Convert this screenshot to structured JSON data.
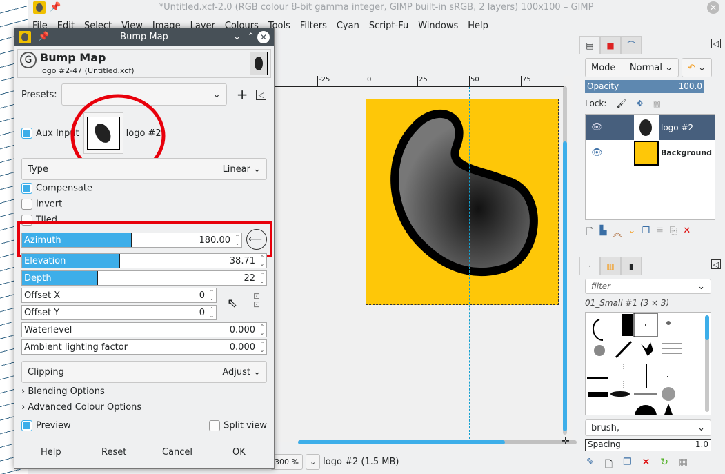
{
  "window": {
    "title": "*Untitled.xcf-2.0 (RGB colour 8-bit gamma integer, GIMP built-in sRGB, 2 layers) 100x100 – GIMP"
  },
  "menu": [
    "File",
    "Edit",
    "Select",
    "View",
    "Image",
    "Layer",
    "Colours",
    "Tools",
    "Filters",
    "Cyan",
    "Script-Fu",
    "Windows",
    "Help"
  ],
  "ruler": [
    "-25",
    "0",
    "25",
    "50",
    "75"
  ],
  "status": {
    "zoom": "300 %",
    "info": "logo #2 (1.5 MB)"
  },
  "layers_panel": {
    "mode_label": "Mode",
    "mode_value": "Normal",
    "opacity_label": "Opacity",
    "opacity_value": "100.0",
    "lock_label": "Lock:",
    "layers": [
      {
        "name": "logo #2",
        "selected": true
      },
      {
        "name": "Background",
        "selected": false
      }
    ]
  },
  "brushes_panel": {
    "filter_placeholder": "filter",
    "brush_name": "01_Small #1 (3 × 3)",
    "tag": "brush,",
    "spacing_label": "Spacing",
    "spacing_value": "1.0"
  },
  "dialog": {
    "title": "Bump Map",
    "heading": "Bump Map",
    "subheading": "logo #2-47 (Untitled.xcf)",
    "presets_label": "Presets:",
    "aux_input_label": "Aux Input",
    "aux_input_checked": true,
    "aux_layer": "logo #2",
    "type_label": "Type",
    "type_value": "Linear",
    "compensate": "Compensate",
    "compensate_checked": true,
    "invert": "Invert",
    "invert_checked": false,
    "tiled": "Tiled",
    "tiled_checked": false,
    "azimuth_label": "Azimuth",
    "azimuth_value": "180.00",
    "azimuth_fraction": 0.5,
    "elevation_label": "Elevation",
    "elevation_value": "38.71",
    "elevation_fraction": 0.43,
    "depth_label": "Depth",
    "depth_value": "22",
    "depth_fraction": 0.3,
    "offset_x_label": "Offset X",
    "offset_x_value": "0",
    "offset_y_label": "Offset Y",
    "offset_y_value": "0",
    "waterlevel_label": "Waterlevel",
    "waterlevel_value": "0.000",
    "ambient_label": "Ambient lighting factor",
    "ambient_value": "0.000",
    "clipping_label": "Clipping",
    "clipping_value": "Adjust",
    "blending": "Blending Options",
    "advanced": "Advanced Colour Options",
    "preview": "Preview",
    "preview_checked": true,
    "split_view": "Split view",
    "split_checked": false,
    "help": "Help",
    "reset": "Reset",
    "cancel": "Cancel",
    "ok": "OK"
  },
  "colors": {
    "accent": "#3daee9",
    "annotation": "#e8000b",
    "canvas_fill": "#fec708",
    "titlebar": "#475057"
  }
}
